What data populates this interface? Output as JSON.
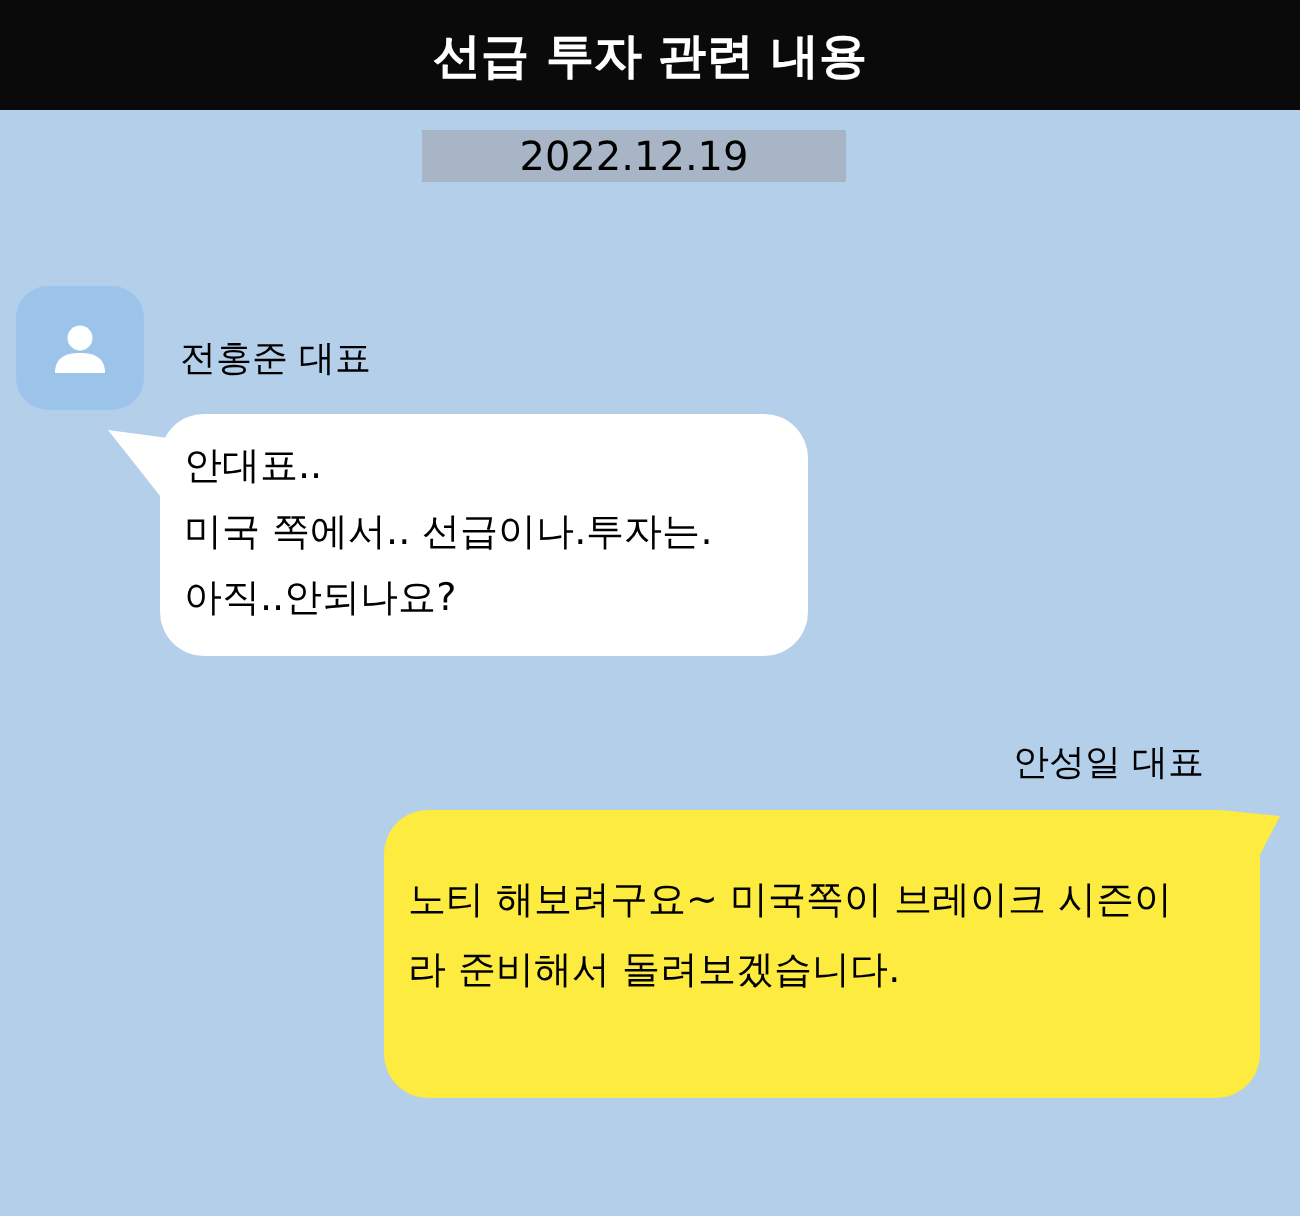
{
  "title": "선급 투자 관련 내용",
  "date": "2022.12.19",
  "messages": [
    {
      "kind": "received",
      "sender": "전홍준 대표",
      "lines": [
        "안대표..",
        "미국 쪽에서.. 선급이나.투자는.",
        "아직..안되나요?"
      ]
    },
    {
      "kind": "sent",
      "sender": "안성일 대표",
      "lines": [
        "노티 해보려구요~ 미국쪽이 브레이크 시즌이",
        "라 준비해서 돌려보겠습니다."
      ]
    }
  ]
}
